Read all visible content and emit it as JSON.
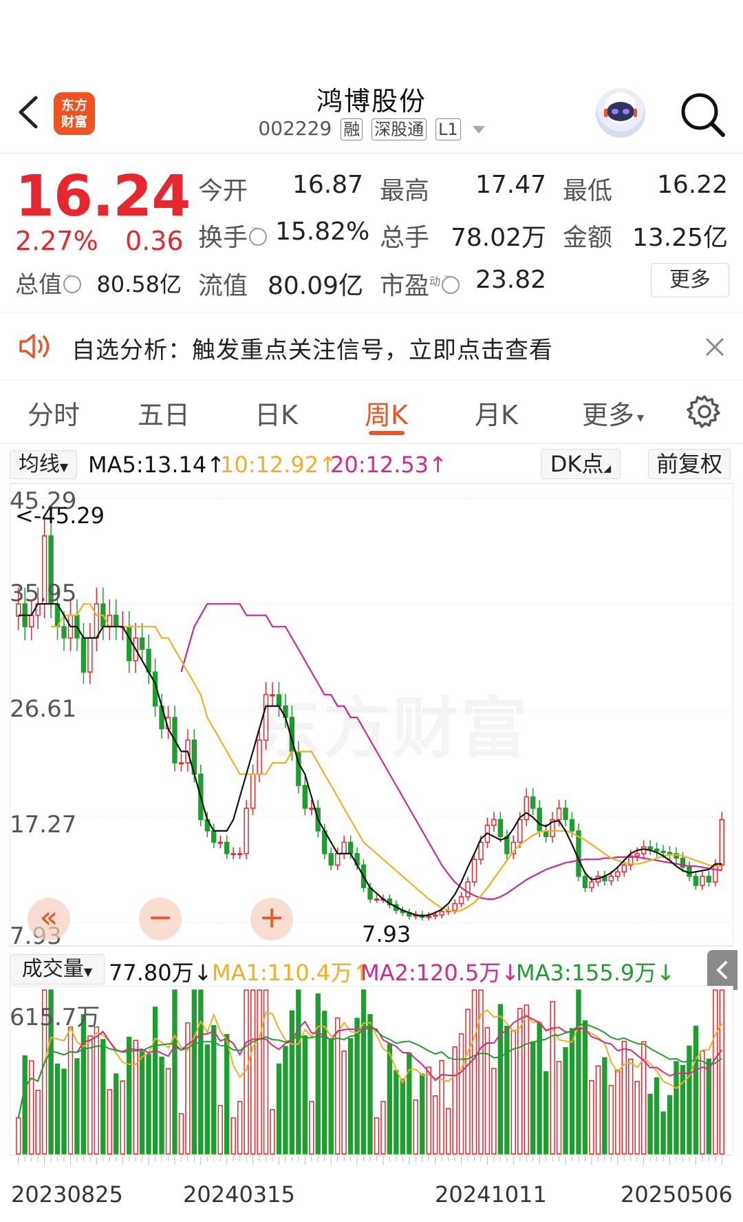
{
  "header": {
    "logo_line1": "东方",
    "logo_line2": "财富",
    "stock_name": "鸿博股份",
    "stock_code": "002229",
    "tags": [
      "融",
      "深股通",
      "L1"
    ]
  },
  "quote": {
    "price": "16.24",
    "change_pct": "2.27%",
    "change": "0.36",
    "stats": [
      {
        "label": "今开",
        "value": "16.87"
      },
      {
        "label": "最高",
        "value": "17.47"
      },
      {
        "label": "最低",
        "value": "16.22"
      },
      {
        "label": "换手",
        "value": "15.82%"
      },
      {
        "label": "总手",
        "value": "78.02万"
      },
      {
        "label": "金额",
        "value": "13.25亿"
      },
      {
        "label": "总值",
        "value": "80.58亿"
      },
      {
        "label": "流值",
        "value": "80.09亿"
      },
      {
        "label": "市盈",
        "value": "23.82"
      }
    ],
    "pe_superscript": "动",
    "more_label": "更多"
  },
  "notice": {
    "text": "自选分析：触发重点关注信号，立即点击查看"
  },
  "tabs": [
    {
      "label": "分时",
      "active": false
    },
    {
      "label": "五日",
      "active": false
    },
    {
      "label": "日K",
      "active": false
    },
    {
      "label": "周K",
      "active": true
    },
    {
      "label": "月K",
      "active": false
    },
    {
      "label": "更多",
      "active": false
    }
  ],
  "kline_bar": {
    "indicator": "均线",
    "ma5": "MA5:13.14",
    "ma10": "10:12.92",
    "ma20": "20:12.53",
    "dk_label": "DK点",
    "adjust_label": "前复权",
    "colors": {
      "ma5": "#111111",
      "ma10": "#f0b021",
      "ma20": "#d6278c",
      "up": "#e8262d",
      "down": "#1e9e2e"
    }
  },
  "chart_axis": {
    "y_ticks": [
      "45.29",
      "35.95",
      "26.61",
      "17.27",
      "7.93"
    ],
    "max_marker": "<-45.29",
    "min_marker": "7.93"
  },
  "volume_bar": {
    "indicator": "成交量",
    "vol": "77.80万",
    "ma1": "MA1:110.4万",
    "ma2": "MA2:120.5万",
    "ma3": "MA3:155.9万",
    "max_label": "615.7万",
    "colors": {
      "ma1": "#f0b021",
      "ma2": "#d6278c",
      "ma3": "#1e9e2e"
    }
  },
  "x_labels": [
    "20230825",
    "20240315",
    "20241011",
    "20250506"
  ],
  "watermark": "东方财富",
  "chart_data": {
    "type": "candlestick",
    "title": "",
    "period": "weekly",
    "ylim": [
      7.93,
      45.29
    ],
    "y_ticks": [
      45.29,
      35.95,
      26.61,
      17.27,
      7.93
    ],
    "x_ticks": [
      "20230825",
      "20240315",
      "20241011",
      "20250506"
    ],
    "close": [
      36,
      34,
      35,
      36,
      42,
      36,
      34,
      33,
      35,
      33,
      30,
      33,
      36,
      34,
      35,
      34,
      34,
      31,
      33,
      32,
      30,
      27,
      25,
      26,
      22,
      22,
      24,
      21,
      17,
      16,
      15,
      15,
      14,
      14,
      14,
      18,
      21,
      24,
      28,
      28,
      27,
      26,
      23,
      20,
      18,
      18,
      16,
      14,
      13,
      14,
      15,
      14,
      13,
      11,
      10,
      10,
      10,
      9.5,
      9,
      8.8,
      8.5,
      8.6,
      8.4,
      8.5,
      8.6,
      8.9,
      9,
      9.6,
      10.2,
      11.5,
      13.5,
      15,
      16.5,
      17,
      15.5,
      14,
      15,
      17,
      19,
      18,
      16,
      15.5,
      17,
      18,
      17,
      16,
      12,
      11,
      11.5,
      12,
      11.6,
      12,
      12.4,
      13,
      13.8,
      14,
      14.6,
      14.4,
      14.2,
      14.1,
      14,
      13.6,
      12.8,
      12,
      11.2,
      12,
      11.5,
      13,
      17
    ],
    "ma5": [
      35,
      35,
      35,
      36,
      36,
      36,
      36,
      35,
      34,
      34,
      33,
      33,
      33,
      34,
      34,
      34,
      34,
      33,
      32,
      31,
      30,
      29,
      27,
      25,
      24,
      23,
      23,
      21,
      19,
      17,
      16,
      16,
      16,
      17,
      19,
      21,
      23,
      25,
      27,
      27,
      27,
      26,
      24,
      22,
      21,
      19,
      17,
      16,
      15,
      14,
      14,
      14,
      13,
      12,
      11,
      10.5,
      10,
      9.6,
      9.3,
      9,
      8.8,
      8.6,
      8.5,
      8.6,
      8.8,
      9.1,
      9.6,
      10.4,
      11.5,
      12.8,
      14,
      15.3,
      15.8,
      15.5,
      15.2,
      15.4,
      16.2,
      17.2,
      17.6,
      17.2,
      16.6,
      16.4,
      16.8,
      16.9,
      16,
      14.8,
      13.5,
      12.3,
      11.7,
      11.8,
      12,
      12.3,
      12.8,
      13.4,
      14,
      14.3,
      14.4,
      14.3,
      14.1,
      13.8,
      13.4,
      12.9,
      12.5,
      12.3,
      12.4,
      12.5,
      12.6,
      13.1,
      13.1
    ],
    "ma10": [
      34,
      34,
      35,
      35,
      35,
      36,
      36,
      35,
      35,
      34,
      34,
      34,
      34,
      34,
      34,
      34,
      34,
      33,
      33,
      32,
      31,
      30,
      29,
      28,
      26,
      25,
      24,
      23,
      22,
      21,
      21,
      21,
      21,
      21,
      22,
      22,
      22,
      23,
      23,
      23,
      23,
      22,
      21,
      20,
      19,
      18,
      17,
      16,
      15,
      14.5,
      14,
      13.5,
      13,
      12.5,
      12,
      11.5,
      11,
      10.5,
      10,
      9.6,
      9.2,
      9,
      8.9,
      9,
      9.3,
      9.7,
      10.3,
      11,
      11.8,
      12.6,
      13.4,
      14.2,
      14.8,
      15.2,
      15.6,
      15.9,
      16,
      16,
      16,
      16,
      15.8,
      15.5,
      15.2,
      14.8,
      14.4,
      14,
      13.6,
      13.4,
      13.2,
      13.1,
      13.1,
      13.2,
      13.4,
      13.6,
      13.8,
      13.9,
      13.9,
      13.8,
      13.6,
      13.4,
      13.2,
      13,
      12.9,
      12.9
    ],
    "ma20": [
      30,
      32,
      34,
      35,
      36,
      36,
      36,
      36,
      36,
      36,
      35,
      35,
      35,
      35,
      34,
      34,
      34,
      33,
      32,
      31,
      30,
      29,
      28,
      28,
      27,
      27,
      26,
      26,
      25,
      24,
      23,
      22,
      21,
      20,
      19,
      18,
      17,
      16,
      15,
      14,
      13,
      12.2,
      11.5,
      11,
      10.6,
      10.3,
      10.1,
      10,
      10,
      10.2,
      10.5,
      10.9,
      11.3,
      11.7,
      12,
      12.3,
      12.6,
      12.8,
      13,
      13.2,
      13.3,
      13.4,
      13.5,
      13.5,
      13.5,
      13.6,
      13.6,
      13.7,
      13.7,
      13.7,
      13.7,
      13.6,
      13.5,
      13.4,
      13.3,
      13.2,
      13.1,
      13,
      12.9,
      12.9,
      12.8,
      12.7,
      12.6,
      12.53
    ]
  }
}
